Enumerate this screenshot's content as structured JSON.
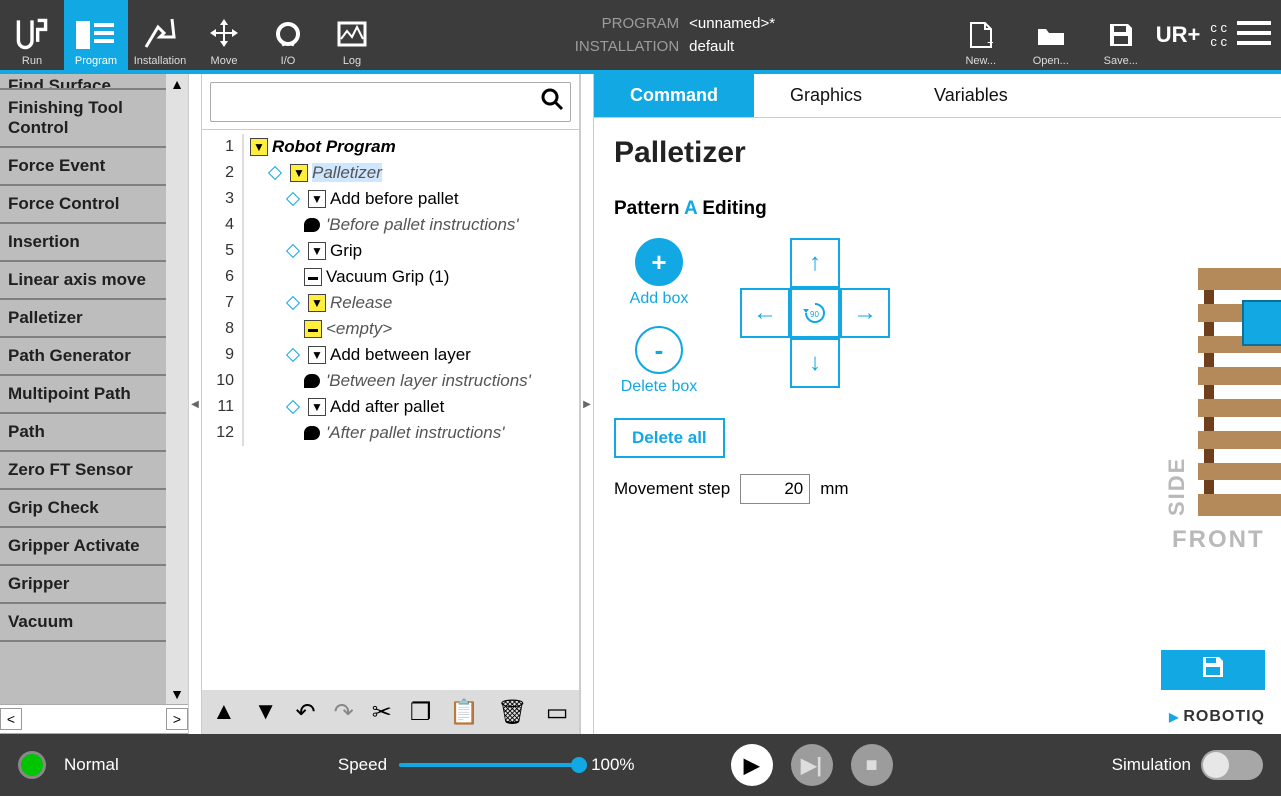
{
  "toolbar": {
    "items": [
      {
        "label": "Run"
      },
      {
        "label": "Program"
      },
      {
        "label": "Installation"
      },
      {
        "label": "Move"
      },
      {
        "label": "I/O"
      },
      {
        "label": "Log"
      }
    ],
    "program_label": "PROGRAM",
    "program_value": "<unnamed>*",
    "install_label": "INSTALLATION",
    "install_value": "default",
    "new": "New...",
    "open": "Open...",
    "save": "Save..."
  },
  "palette": [
    "Find Surface",
    "Finishing Tool Control",
    "Force Event",
    "Force Control",
    "Insertion",
    "Linear axis move",
    "Palletizer",
    "Path Generator",
    "Multipoint Path",
    "Path",
    "Zero FT Sensor",
    "Grip Check",
    "Gripper Activate",
    "Gripper",
    "Vacuum"
  ],
  "tree": [
    {
      "n": 1,
      "indent": 0,
      "tri": "yellow",
      "label": "Robot Program",
      "style": "bolditalic"
    },
    {
      "n": 2,
      "indent": 1,
      "diam": true,
      "tri": "yellow",
      "label": "Palletizer",
      "style": "italic",
      "selected": true
    },
    {
      "n": 3,
      "indent": 2,
      "diam": true,
      "tri": "white",
      "label": "Add before pallet"
    },
    {
      "n": 4,
      "indent": 3,
      "bubble": true,
      "label": "'Before pallet instructions'",
      "style": "italic"
    },
    {
      "n": 5,
      "indent": 2,
      "diam": true,
      "tri": "white",
      "label": "Grip"
    },
    {
      "n": 6,
      "indent": 3,
      "minus": "white",
      "label": "Vacuum Grip  (1)"
    },
    {
      "n": 7,
      "indent": 2,
      "diam": true,
      "tri": "yellow",
      "label": "Release",
      "style": "italic"
    },
    {
      "n": 8,
      "indent": 3,
      "minus": "yellow",
      "label": "<empty>",
      "style": "italic"
    },
    {
      "n": 9,
      "indent": 2,
      "diam": true,
      "tri": "white",
      "label": "Add between layer"
    },
    {
      "n": 10,
      "indent": 3,
      "bubble": true,
      "label": "'Between layer instructions'",
      "style": "italic"
    },
    {
      "n": 11,
      "indent": 2,
      "diam": true,
      "tri": "white",
      "label": "Add after pallet"
    },
    {
      "n": 12,
      "indent": 3,
      "bubble": true,
      "label": "'After pallet instructions'",
      "style": "italic"
    }
  ],
  "tree_icons": [
    "up",
    "down",
    "undo",
    "redo",
    "cut",
    "copy",
    "paste",
    "delete",
    "select"
  ],
  "tabs": [
    "Command",
    "Graphics",
    "Variables"
  ],
  "panel": {
    "title": "Palletizer",
    "pattern_word": "Pattern",
    "pattern_letter": "A",
    "pattern_editing": "Editing",
    "add_box": "Add box",
    "delete_box": "Delete box",
    "delete_all": "Delete all",
    "move_step_label": "Movement step",
    "move_step_value": "20",
    "move_step_unit": "mm",
    "side": "SIDE",
    "front": "FRONT",
    "robotiq": "ROBOTIQ"
  },
  "bottom": {
    "status": "Normal",
    "speed_label": "Speed",
    "speed_value": "100%",
    "sim_label": "Simulation"
  },
  "colors": {
    "accent": "#11a8e3",
    "wood": "#b48a5a",
    "woodDark": "#6e3f1d"
  }
}
